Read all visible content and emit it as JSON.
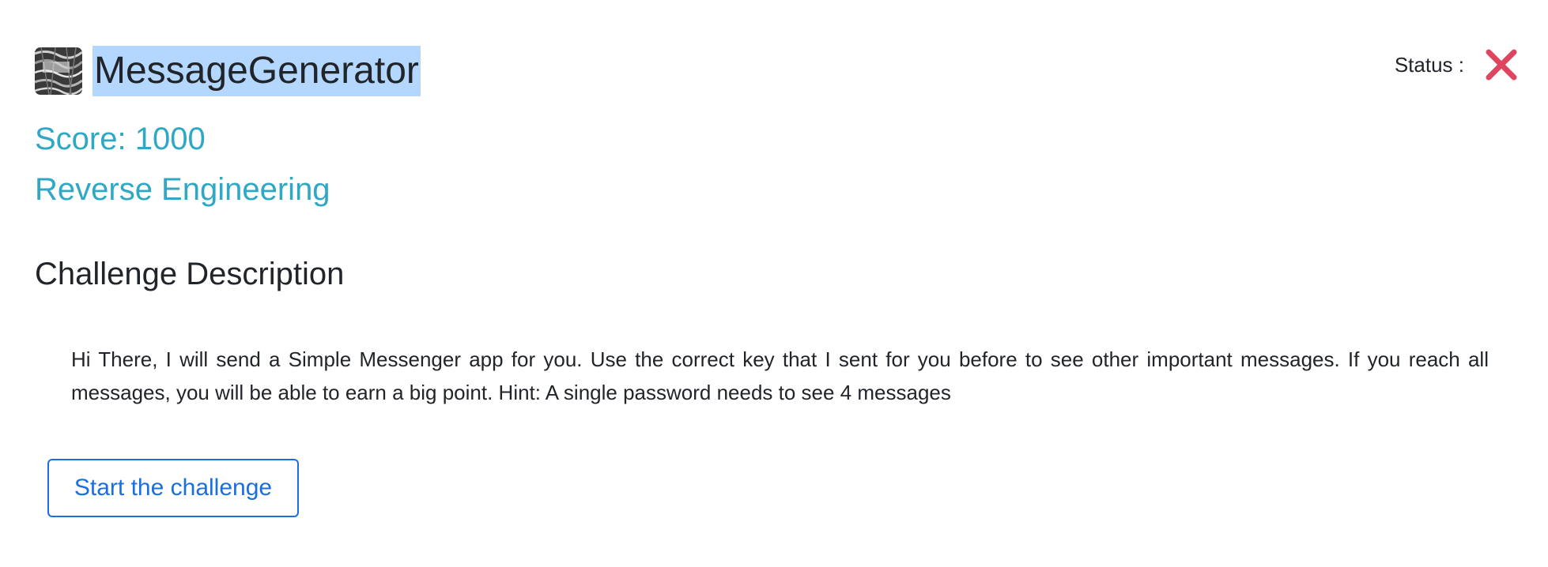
{
  "challenge": {
    "title": "MessageGenerator",
    "icon": "challenge-thumbnail-icon",
    "score_text": "Score: 1000",
    "category": "Reverse Engineering"
  },
  "status": {
    "label": "Status :",
    "icon": "close-icon",
    "icon_color": "#e0455f"
  },
  "description": {
    "heading": "Challenge Description",
    "text": "Hi There, I will send a Simple Messenger app for you. Use the correct key that I sent for you before to see other important messages. If you reach all messages, you will be able to earn a big point.  Hint: A single password needs to see 4 messages"
  },
  "actions": {
    "start_label": "Start the challenge"
  },
  "colors": {
    "accent": "#2fa8c5",
    "button": "#1a6fe0",
    "selection": "#b3d7ff"
  }
}
